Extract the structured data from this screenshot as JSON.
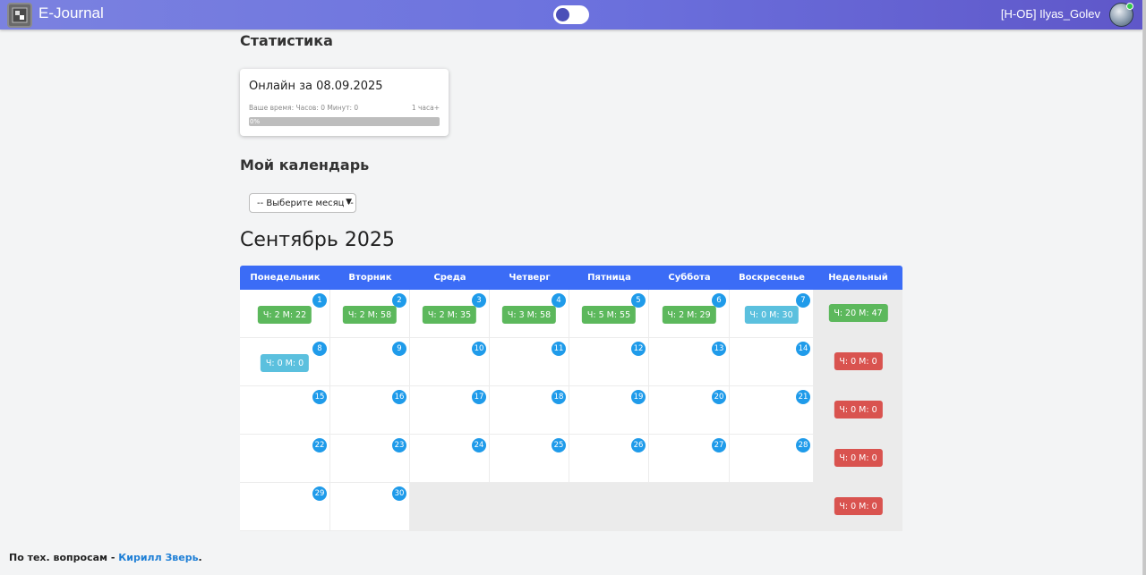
{
  "header": {
    "brand": "E-Journal",
    "user": "[Н-ОБ] Ilyas_Golev"
  },
  "stats": {
    "title": "Статистика",
    "card_title": "Онлайн за 08.09.2025",
    "your_time": "Ваше время: Часов: 0 Минут: 0",
    "goal": "1 часа+",
    "progress_label": "0%",
    "progress_value": 0
  },
  "calendar_section": {
    "title": "Мой календарь",
    "select_value": "-- Выберите месяц --",
    "month_title": "Сентябрь 2025"
  },
  "calendar": {
    "headers": [
      "Понедельник",
      "Вторник",
      "Среда",
      "Четверг",
      "Пятница",
      "Суббота",
      "Воскресенье",
      "Недельный"
    ],
    "rows": [
      [
        {
          "day": "1",
          "badge": "Ч: 2 М: 22",
          "color": "#5cb85c"
        },
        {
          "day": "2",
          "badge": "Ч: 2 М: 58",
          "color": "#5cb85c"
        },
        {
          "day": "3",
          "badge": "Ч: 2 М: 35",
          "color": "#5cb85c"
        },
        {
          "day": "4",
          "badge": "Ч: 3 М: 58",
          "color": "#5cb85c"
        },
        {
          "day": "5",
          "badge": "Ч: 5 М: 55",
          "color": "#5cb85c"
        },
        {
          "day": "6",
          "badge": "Ч: 2 М: 29",
          "color": "#5cb85c"
        },
        {
          "day": "7",
          "badge": "Ч: 0 М: 30",
          "color": "#5bc0de"
        },
        {
          "week": true,
          "badge": "Ч: 20 М: 47",
          "color": "#5cb85c"
        }
      ],
      [
        {
          "day": "8",
          "badge": "Ч: 0 М: 0",
          "color": "#5bc0de"
        },
        {
          "day": "9"
        },
        {
          "day": "10"
        },
        {
          "day": "11"
        },
        {
          "day": "12"
        },
        {
          "day": "13"
        },
        {
          "day": "14"
        },
        {
          "week": true,
          "badge": "Ч: 0 М: 0",
          "color": "#d9534f"
        }
      ],
      [
        {
          "day": "15"
        },
        {
          "day": "16"
        },
        {
          "day": "17"
        },
        {
          "day": "18"
        },
        {
          "day": "19"
        },
        {
          "day": "20"
        },
        {
          "day": "21"
        },
        {
          "week": true,
          "badge": "Ч: 0 М: 0",
          "color": "#d9534f"
        }
      ],
      [
        {
          "day": "22"
        },
        {
          "day": "23"
        },
        {
          "day": "24"
        },
        {
          "day": "25"
        },
        {
          "day": "26"
        },
        {
          "day": "27"
        },
        {
          "day": "28"
        },
        {
          "week": true,
          "badge": "Ч: 0 М: 0",
          "color": "#d9534f"
        }
      ],
      [
        {
          "day": "29"
        },
        {
          "day": "30"
        },
        {
          "empty": true
        },
        {
          "empty": true
        },
        {
          "empty": true
        },
        {
          "empty": true
        },
        {
          "empty": true
        },
        {
          "week": true,
          "badge": "Ч: 0 М: 0",
          "color": "#d9534f"
        }
      ]
    ]
  },
  "footer": {
    "text": "По тех. вопросам - ",
    "link": "Кирилл Зверь",
    "suffix": "."
  }
}
